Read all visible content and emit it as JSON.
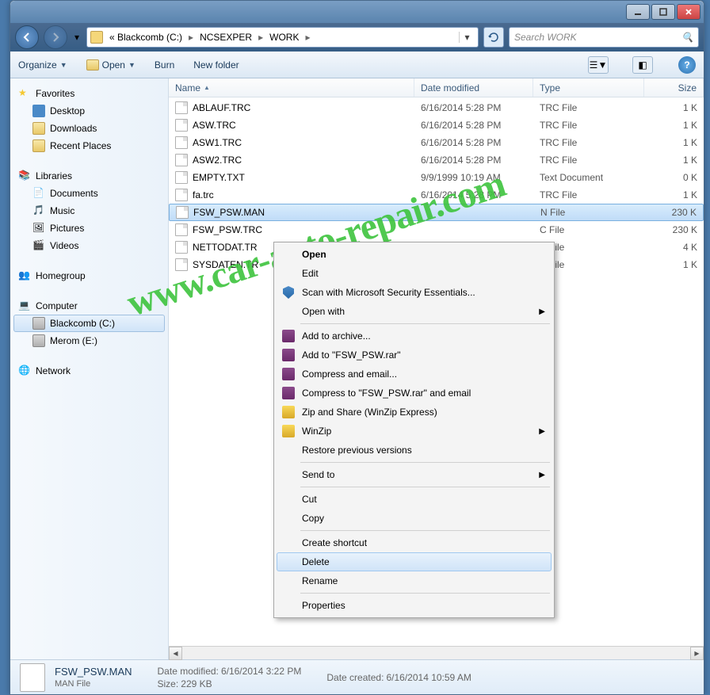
{
  "breadcrumbs": {
    "root": "« Blackcomb (C:)",
    "mid": "NCSEXPER",
    "leaf": "WORK"
  },
  "search": {
    "placeholder": "Search WORK"
  },
  "toolbar": {
    "organize": "Organize",
    "open": "Open",
    "burn": "Burn",
    "newfolder": "New folder"
  },
  "columns": {
    "name": "Name",
    "date": "Date modified",
    "type": "Type",
    "size": "Size"
  },
  "sidebar": {
    "favorites": "Favorites",
    "fav_items": [
      "Desktop",
      "Downloads",
      "Recent Places"
    ],
    "libraries": "Libraries",
    "lib_items": [
      "Documents",
      "Music",
      "Pictures",
      "Videos"
    ],
    "homegroup": "Homegroup",
    "computer": "Computer",
    "drives": [
      "Blackcomb (C:)",
      "Merom (E:)"
    ],
    "network": "Network"
  },
  "files": [
    {
      "name": "ABLAUF.TRC",
      "date": "6/16/2014 5:28 PM",
      "type": "TRC File",
      "size": "1 K"
    },
    {
      "name": "ASW.TRC",
      "date": "6/16/2014 5:28 PM",
      "type": "TRC File",
      "size": "1 K"
    },
    {
      "name": "ASW1.TRC",
      "date": "6/16/2014 5:28 PM",
      "type": "TRC File",
      "size": "1 K"
    },
    {
      "name": "ASW2.TRC",
      "date": "6/16/2014 5:28 PM",
      "type": "TRC File",
      "size": "1 K"
    },
    {
      "name": "EMPTY.TXT",
      "date": "9/9/1999 10:19 AM",
      "type": "Text Document",
      "size": "0 K"
    },
    {
      "name": "fa.trc",
      "date": "6/16/2014 5:28 PM",
      "type": "TRC File",
      "size": "1 K"
    },
    {
      "name": "FSW_PSW.MAN",
      "date": "",
      "type": "N File",
      "size": "230 K"
    },
    {
      "name": "FSW_PSW.TRC",
      "date": "",
      "type": "C File",
      "size": "230 K"
    },
    {
      "name": "NETTODAT.TR",
      "date": "",
      "type": "C File",
      "size": "4 K"
    },
    {
      "name": "SYSDATEN.TR",
      "date": "",
      "type": "C File",
      "size": "1 K"
    }
  ],
  "selected_file_index": 6,
  "context_menu": {
    "open": "Open",
    "edit": "Edit",
    "scan": "Scan with Microsoft Security Essentials...",
    "openwith": "Open with",
    "addarchive": "Add to archive...",
    "addrar": "Add to \"FSW_PSW.rar\"",
    "compressemail": "Compress and email...",
    "compressrartoemail": "Compress to \"FSW_PSW.rar\" and email",
    "zipshare": "Zip and Share (WinZip Express)",
    "winzip": "WinZip",
    "restore": "Restore previous versions",
    "sendto": "Send to",
    "cut": "Cut",
    "copy": "Copy",
    "shortcut": "Create shortcut",
    "delete": "Delete",
    "rename": "Rename",
    "properties": "Properties"
  },
  "details": {
    "name": "FSW_PSW.MAN",
    "modified_label": "Date modified:",
    "modified": "6/16/2014 3:22 PM",
    "created_label": "Date created:",
    "created": "6/16/2014 10:59 AM",
    "type": "MAN File",
    "size_label": "Size:",
    "size": "229 KB"
  },
  "watermark": "www.car-auto-repair.com"
}
